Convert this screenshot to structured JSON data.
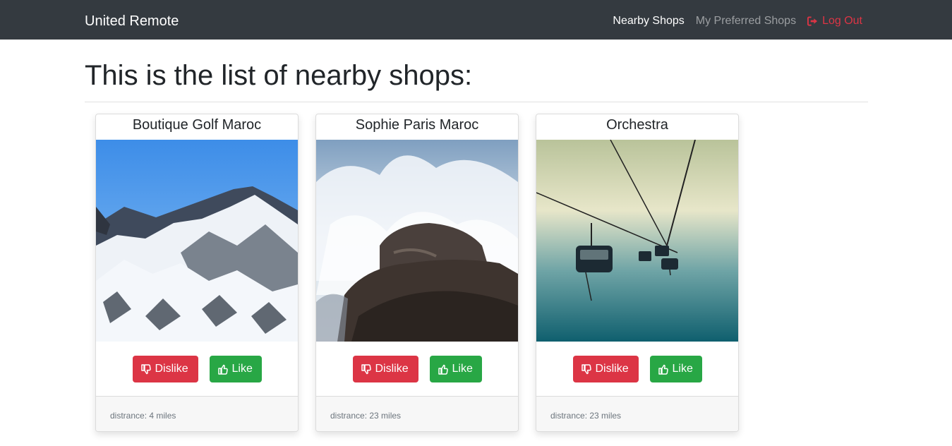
{
  "navbar": {
    "brand": "United Remote",
    "links": [
      {
        "label": "Nearby Shops",
        "state": "active"
      },
      {
        "label": "My Preferred Shops",
        "state": "muted"
      }
    ],
    "logout_label": "Log Out",
    "logout_icon": "sign-out-icon"
  },
  "page": {
    "heading": "This is the list of nearby shops:"
  },
  "shops": [
    {
      "name": "Boutique Golf Maroc",
      "image": "snowy-mountain-photo",
      "dislike_label": "Dislike",
      "like_label": "Like",
      "distance": "distrance: 4 miles"
    },
    {
      "name": "Sophie Paris Maroc",
      "image": "ocean-wave-rock-photo",
      "dislike_label": "Dislike",
      "like_label": "Like",
      "distance": "distrance: 23 miles"
    },
    {
      "name": "Orchestra",
      "image": "ski-lift-photo",
      "dislike_label": "Dislike",
      "like_label": "Like",
      "distance": "distrance: 23 miles"
    }
  ],
  "colors": {
    "navbar_bg": "#343a40",
    "danger": "#dc3545",
    "success": "#28a745"
  },
  "icons": {
    "dislike": "thumbs-down-icon",
    "like": "thumbs-up-icon"
  }
}
